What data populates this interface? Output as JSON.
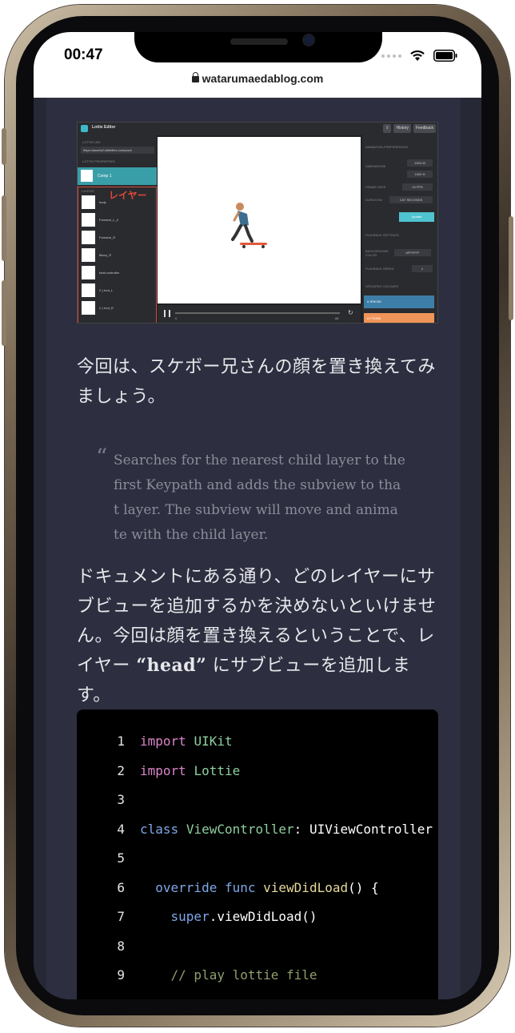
{
  "status_bar": {
    "time": "00:47",
    "url": "watarumaedablog.com",
    "lock_icon": "lock-icon",
    "wifi_icon": "wifi-icon",
    "battery_icon": "battery-icon"
  },
  "lottie_editor": {
    "title": "Lottie Editor",
    "buttons": [
      "History",
      "Feedback"
    ],
    "url_label": "LOTTIE URL",
    "url_value": "https://assets2.lottiefiles.com/pack",
    "properties_label": "LOTTIE PROPERTIES",
    "comp_name": "Comp 1",
    "layers_label": "LAYERS",
    "annotation": "レイヤー",
    "layers": [
      "body",
      "Forearm_L_2",
      "Forearm_R",
      "Bicep_R",
      "total controller",
      "C | foot_L",
      "C | foot_R"
    ],
    "animation_label": "ANIMATION PREFERENCES",
    "dimensions_label": "DIMENSIONS",
    "width": "1920",
    "height": "1920",
    "w_label": "W",
    "h_label": "H",
    "frame_rate_label": "FRAME RATE",
    "frame_rate": "24",
    "fps_label": "FPS",
    "duration_label": "DURATION",
    "duration": "3.67",
    "seconds_label": "SECONDS",
    "update_label": "Update",
    "playback_label": "PLAYBACK SETTINGS",
    "bg_color_label": "BACKGROUND COLOR",
    "bg_color": "#FFFFFF",
    "playback_speed_label": "PLAYBACK SPEED",
    "playback_speed": "1",
    "color_label": "GROUPED COLOURS",
    "blue_swatch": "# 3F6C85",
    "orange_swatch": "# F7935E",
    "player_start": "0",
    "player_end": "88"
  },
  "paragraph1": "今回は、スケボー兄さんの顔を置き換えてみましょう。",
  "quote": "Searches for the nearest child layer to the first Keypath and adds the subview to that layer. The subview will move and animate with the child layer.",
  "quote_lines": [
    "Searches for the nearest child layer to the",
    "first Keypath and adds the subview to tha",
    "t layer. The subview will move and anima",
    "te with the child layer."
  ],
  "paragraph2_before": "ドキュメントにある通り、どのレイヤーにサブビューを追加するかを決めないといけません。今回は顔を置き換えるということで、レイヤー ",
  "paragraph2_bold": "“head”",
  "paragraph2_after": " にサブビューを追加します。",
  "code": {
    "lines": [
      {
        "n": "1",
        "parts": [
          [
            "kw",
            "import"
          ],
          [
            "",
            " "
          ],
          [
            "ty",
            "UIKit"
          ]
        ]
      },
      {
        "n": "2",
        "parts": [
          [
            "kw",
            "import"
          ],
          [
            "",
            " "
          ],
          [
            "ty",
            "Lottie"
          ]
        ]
      },
      {
        "n": "3",
        "parts": []
      },
      {
        "n": "4",
        "parts": [
          [
            "kw2",
            "class"
          ],
          [
            "",
            " "
          ],
          [
            "ty",
            "ViewController"
          ],
          [
            "",
            ": UIViewController {"
          ]
        ]
      },
      {
        "n": "5",
        "parts": []
      },
      {
        "n": "6",
        "parts": [
          [
            "",
            "  "
          ],
          [
            "kw2",
            "override"
          ],
          [
            "",
            " "
          ],
          [
            "kw2",
            "func"
          ],
          [
            "",
            " "
          ],
          [
            "fn",
            "viewDidLoad"
          ],
          [
            "",
            "() {"
          ]
        ]
      },
      {
        "n": "7",
        "parts": [
          [
            "",
            "    "
          ],
          [
            "kw2",
            "super"
          ],
          [
            "",
            ".viewDidLoad()"
          ]
        ]
      },
      {
        "n": "8",
        "parts": []
      },
      {
        "n": "9",
        "parts": [
          [
            "",
            "    "
          ],
          [
            "cm",
            "// play lottie file"
          ]
        ]
      }
    ]
  }
}
